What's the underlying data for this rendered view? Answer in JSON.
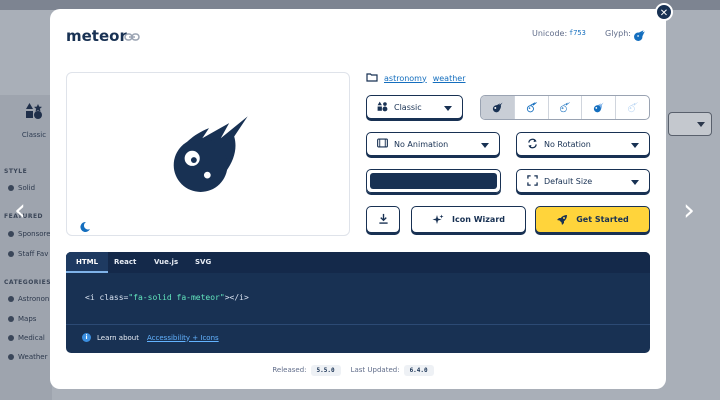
{
  "background": {
    "style_tile_label": "Classic",
    "sections": [
      {
        "title": "STYLE",
        "items": [
          "Solid"
        ]
      },
      {
        "title": "FEATURED",
        "items": [
          "Sponsore",
          "Staff Fav"
        ]
      },
      {
        "title": "CATEGORIES",
        "items": [
          "Astronon",
          "Maps",
          "Medical",
          "Weather"
        ]
      }
    ]
  },
  "modal": {
    "title": "meteor",
    "unicode_label": "Unicode:",
    "unicode_value": "f753",
    "glyph_label": "Glyph:",
    "categories": [
      "astronomy",
      "weather"
    ],
    "style_dropdown": "Classic",
    "animation_dropdown": "No Animation",
    "rotation_dropdown": "No Rotation",
    "size_dropdown": "Default Size",
    "color": "#183153",
    "icon_wizard_label": "Icon Wizard",
    "get_started_label": "Get Started",
    "code_tabs": [
      "HTML",
      "React",
      "Vue.js",
      "SVG"
    ],
    "active_tab": "HTML",
    "code_prefix": "<i class=",
    "code_class": "\"fa-solid fa-meteor\"",
    "code_suffix": "></i>",
    "learn_about": "Learn about",
    "learn_link": "Accessibility + Icons",
    "released_label": "Released:",
    "released_version": "5.5.0",
    "updated_label": "Last Updated:",
    "updated_version": "6.4.0"
  },
  "colors": {
    "navy": "#183153",
    "yellow": "#ffd43b",
    "link": "#146ebe"
  }
}
